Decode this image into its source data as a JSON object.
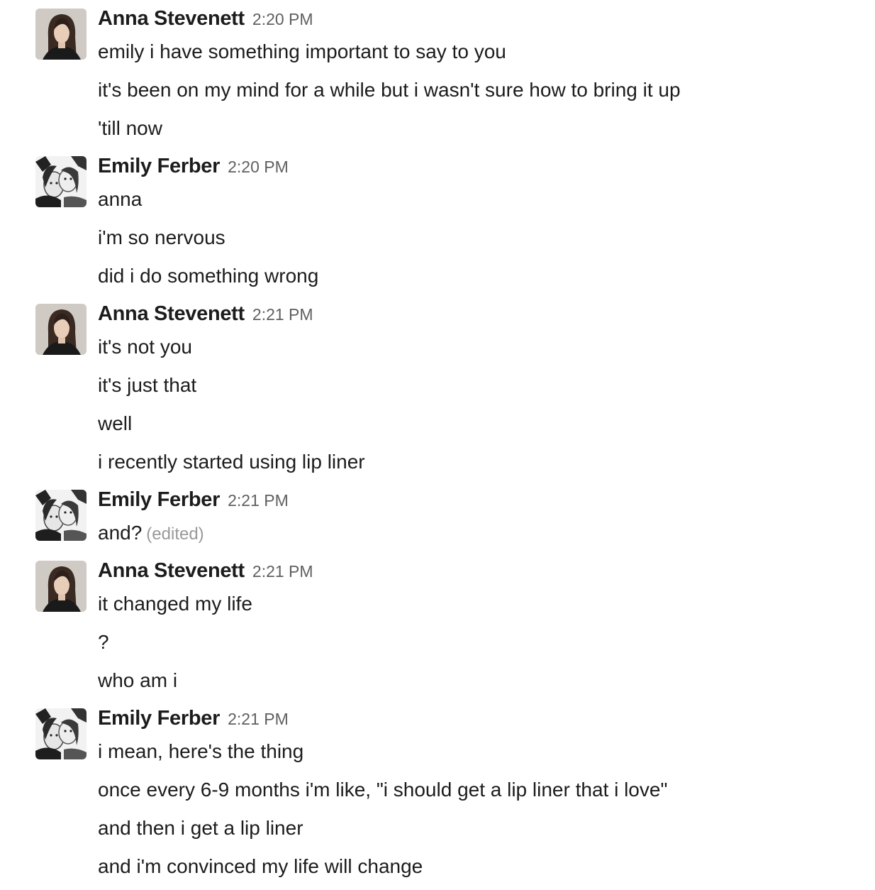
{
  "messages": [
    {
      "author": "Anna Stevenett",
      "time": "2:20 PM",
      "avatar": "woman-portrait-avatar",
      "lines": [
        "emily i have something important to say to you",
        "it's been on my mind for a while but i wasn't sure how to bring it up",
        "'till now"
      ]
    },
    {
      "author": "Emily Ferber",
      "time": "2:20 PM",
      "avatar": "two-women-bw-avatar",
      "lines": [
        "anna",
        "i'm so nervous",
        "did i do something wrong"
      ]
    },
    {
      "author": "Anna Stevenett",
      "time": "2:21 PM",
      "avatar": "woman-portrait-avatar",
      "lines": [
        "it's not you",
        "it's just that",
        "well",
        "i recently started using lip liner"
      ]
    },
    {
      "author": "Emily Ferber",
      "time": "2:21 PM",
      "avatar": "two-women-bw-avatar",
      "lines": [
        "and?"
      ],
      "edited": "(edited)"
    },
    {
      "author": "Anna Stevenett",
      "time": "2:21 PM",
      "avatar": "woman-portrait-avatar",
      "lines": [
        "it changed my life",
        "?",
        "who am i"
      ]
    },
    {
      "author": "Emily Ferber",
      "time": "2:21 PM",
      "avatar": "two-women-bw-avatar",
      "lines": [
        "i mean, here's the thing",
        "once every 6-9 months i'm like, \"i should get a lip liner that i love\"",
        "and then i get a lip liner",
        "and i'm convinced my life will change"
      ]
    }
  ]
}
